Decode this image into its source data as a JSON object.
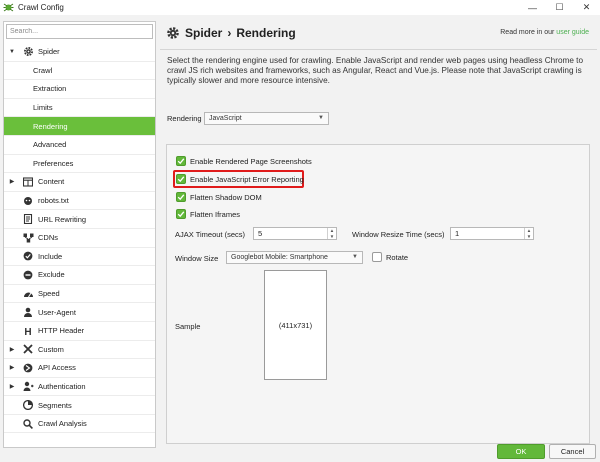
{
  "window": {
    "title": "Crawl Config",
    "minimize": "—",
    "maximize": "☐",
    "close": "✕"
  },
  "sidebar": {
    "search_placeholder": "Search...",
    "items": [
      {
        "label": "Spider",
        "icon": "gear-icon",
        "arrow": "▼",
        "level": "top"
      },
      {
        "label": "Crawl",
        "level": "sub"
      },
      {
        "label": "Extraction",
        "level": "sub"
      },
      {
        "label": "Limits",
        "level": "sub"
      },
      {
        "label": "Rendering",
        "level": "sub",
        "selected": true
      },
      {
        "label": "Advanced",
        "level": "sub"
      },
      {
        "label": "Preferences",
        "level": "sub"
      },
      {
        "label": "Content",
        "icon": "content-icon",
        "arrow": "▶",
        "level": "top"
      },
      {
        "label": "robots.txt",
        "icon": "robot-icon",
        "level": "top"
      },
      {
        "label": "URL Rewriting",
        "icon": "rewrite-icon",
        "level": "top"
      },
      {
        "label": "CDNs",
        "icon": "cdn-icon",
        "level": "top"
      },
      {
        "label": "Include",
        "icon": "include-icon",
        "level": "top"
      },
      {
        "label": "Exclude",
        "icon": "exclude-icon",
        "level": "top"
      },
      {
        "label": "Speed",
        "icon": "speed-icon",
        "level": "top"
      },
      {
        "label": "User-Agent",
        "icon": "user-agent-icon",
        "level": "top"
      },
      {
        "label": "HTTP Header",
        "icon": "http-header-icon",
        "level": "top"
      },
      {
        "label": "Custom",
        "icon": "custom-icon",
        "arrow": "▶",
        "level": "top"
      },
      {
        "label": "API Access",
        "icon": "api-icon",
        "arrow": "▶",
        "level": "top"
      },
      {
        "label": "Authentication",
        "icon": "authentication-icon",
        "arrow": "▶",
        "level": "top"
      },
      {
        "label": "Segments",
        "icon": "segments-icon",
        "level": "top"
      },
      {
        "label": "Crawl Analysis",
        "icon": "crawl-analysis-icon",
        "level": "top"
      }
    ]
  },
  "header": {
    "section": "Spider",
    "separator": "›",
    "page": "Rendering",
    "readmore_prefix": "Read more in our",
    "readmore_link": "user guide"
  },
  "description": "Select the rendering engine used for crawling. Enable JavaScript and render web pages using headless Chrome to crawl JS rich websites and frameworks, such as Angular, React and Vue.js. Please note that JavaScript crawling is typically slower and more resource intensive.",
  "rendering": {
    "label": "Rendering",
    "value": "JavaScript"
  },
  "options": {
    "screenshots": {
      "label": "Enable Rendered Page Screenshots",
      "checked": true
    },
    "js_errors": {
      "label": "Enable JavaScript Error Reporting",
      "checked": true
    },
    "shadow_dom": {
      "label": "Flatten Shadow DOM",
      "checked": true
    },
    "iframes": {
      "label": "Flatten Iframes",
      "checked": true
    },
    "ajax_timeout": {
      "label": "AJAX Timeout (secs)",
      "value": "5"
    },
    "window_resize": {
      "label": "Window Resize Time (secs)",
      "value": "1"
    },
    "window_size": {
      "label": "Window Size",
      "value": "Googlebot Mobile: Smartphone"
    },
    "rotate": {
      "label": "Rotate",
      "checked": false
    },
    "sample": {
      "label": "Sample",
      "dimensions": "(411x731)"
    }
  },
  "footer": {
    "ok": "OK",
    "cancel": "Cancel"
  },
  "colors": {
    "accent": "#6abf3b",
    "highlight": "#e01b1b"
  }
}
